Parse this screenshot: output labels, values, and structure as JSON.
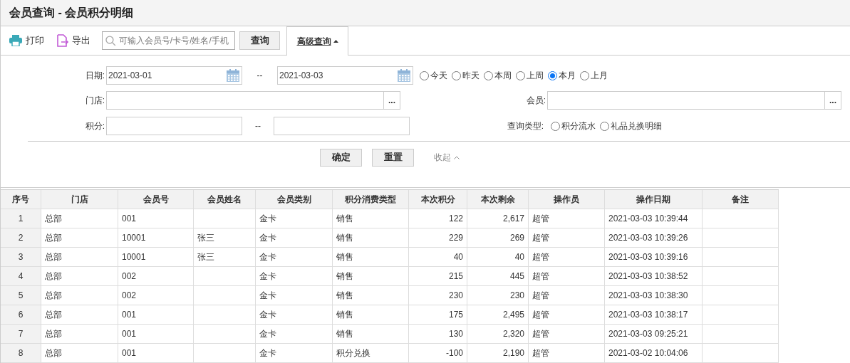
{
  "window": {
    "title": "会员查询 - 会员积分明细"
  },
  "toolbar": {
    "print": "打印",
    "export": "导出",
    "search": {
      "placeholder": "可输入会员号/卡号/姓名/手机"
    },
    "query_button": "查询",
    "advanced_tab": {
      "label": "高级查询",
      "expanded": true
    }
  },
  "filters": {
    "date": {
      "label": "日期:",
      "from": "2021-03-01",
      "separator": "--",
      "to": "2021-03-03"
    },
    "date_presets": [
      {
        "label": "今天",
        "selected": false
      },
      {
        "label": "昨天",
        "selected": false
      },
      {
        "label": "本周",
        "selected": false
      },
      {
        "label": "上周",
        "selected": false
      },
      {
        "label": "本月",
        "selected": true
      },
      {
        "label": "上月",
        "selected": false
      }
    ],
    "store": {
      "label": "门店:",
      "more": "..."
    },
    "member": {
      "label": "会员:",
      "more": "..."
    },
    "points": {
      "label": "积分:",
      "separator": "--"
    },
    "query_type": {
      "label": "查询类型:",
      "options": [
        {
          "label": "积分流水",
          "selected": false
        },
        {
          "label": "礼品兑换明细",
          "selected": false
        }
      ]
    },
    "confirm": "确定",
    "reset": "重置",
    "collapse": "收起"
  },
  "table": {
    "columns": [
      "序号",
      "门店",
      "会员号",
      "会员姓名",
      "会员类别",
      "积分消费类型",
      "本次积分",
      "本次剩余",
      "操作员",
      "操作日期",
      "备注"
    ],
    "rows": [
      [
        "1",
        "总部",
        "001",
        "",
        "金卡",
        "销售",
        "122",
        "2,617",
        "超管",
        "2021-03-03 10:39:44",
        ""
      ],
      [
        "2",
        "总部",
        "10001",
        "张三",
        "金卡",
        "销售",
        "229",
        "269",
        "超管",
        "2021-03-03 10:39:26",
        ""
      ],
      [
        "3",
        "总部",
        "10001",
        "张三",
        "金卡",
        "销售",
        "40",
        "40",
        "超管",
        "2021-03-03 10:39:16",
        ""
      ],
      [
        "4",
        "总部",
        "002",
        "",
        "金卡",
        "销售",
        "215",
        "445",
        "超管",
        "2021-03-03 10:38:52",
        ""
      ],
      [
        "5",
        "总部",
        "002",
        "",
        "金卡",
        "销售",
        "230",
        "230",
        "超管",
        "2021-03-03 10:38:30",
        ""
      ],
      [
        "6",
        "总部",
        "001",
        "",
        "金卡",
        "销售",
        "175",
        "2,495",
        "超管",
        "2021-03-03 10:38:17",
        ""
      ],
      [
        "7",
        "总部",
        "001",
        "",
        "金卡",
        "销售",
        "130",
        "2,320",
        "超管",
        "2021-03-03 09:25:21",
        ""
      ],
      [
        "8",
        "总部",
        "001",
        "",
        "金卡",
        "积分兑换",
        "-100",
        "2,190",
        "超管",
        "2021-03-02 10:04:06",
        ""
      ]
    ]
  }
}
